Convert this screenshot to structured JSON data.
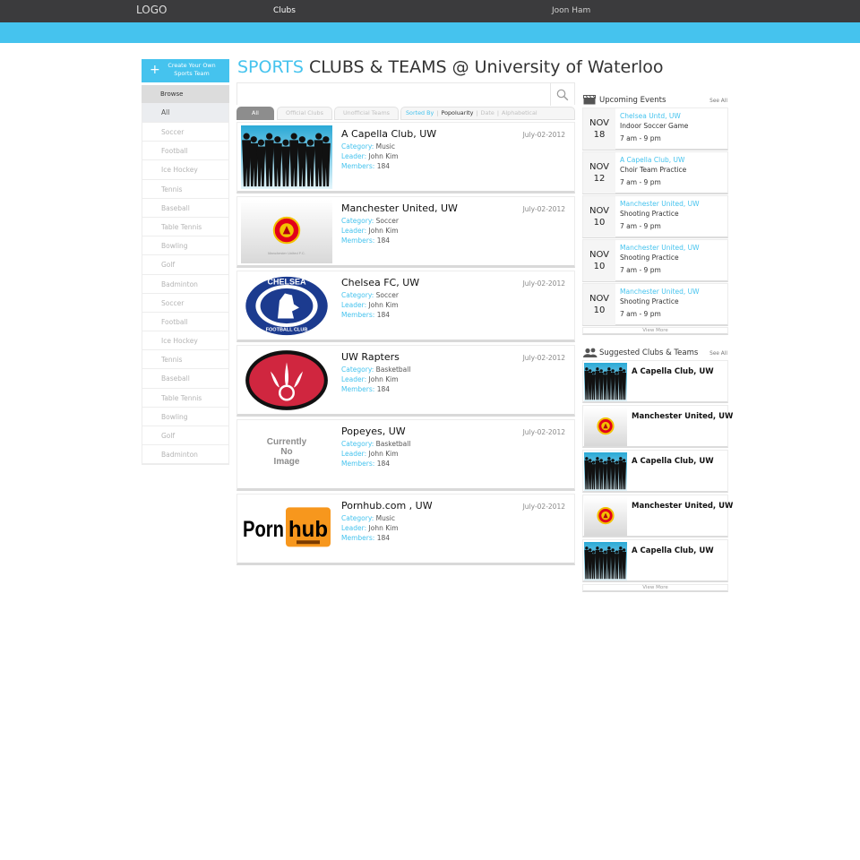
{
  "topbar": {
    "logo": "LOGO",
    "nav_clubs": "Clubs",
    "user": "Joon Ham"
  },
  "sidebar": {
    "create_label": "Create Your Own Sports Team",
    "browse_label": "Browse",
    "items": [
      "All",
      "Soccer",
      "Football",
      "Ice Hockey",
      "Tennis",
      "Baseball",
      "Table Tennis",
      "Bowling",
      "Golf",
      "Badminton",
      "Soccer",
      "Football",
      "Ice Hockey",
      "Tennis",
      "Baseball",
      "Table Tennis",
      "Bowling",
      "Golf",
      "Badminton"
    ]
  },
  "header": {
    "highlight": "SPORTS",
    "rest": " CLUBS & TEAMS @ University of Waterloo"
  },
  "filters": {
    "tabs": [
      "All",
      "Official Clubs",
      "Unofficial Teams"
    ],
    "sorted_by": "Sorted By",
    "sort_options": [
      "Popoluarity",
      "Date",
      "Alphabetical"
    ]
  },
  "club_labels": {
    "category": "Category:",
    "leader": "Leader:",
    "members": "Members:"
  },
  "clubs": [
    {
      "name": "A Capella Club, UW",
      "date": "July-02-2012",
      "category": "Music",
      "leader": "John Kim",
      "members": "184",
      "image": "silhouette-group"
    },
    {
      "name": "Manchester United, UW",
      "date": "July-02-2012",
      "category": "Soccer",
      "leader": "John Kim",
      "members": "184",
      "image": "manutd-crest",
      "image_caption": "Manchester United F.C."
    },
    {
      "name": "Chelsea FC, UW",
      "date": "July-02-2012",
      "category": "Soccer",
      "leader": "John Kim",
      "members": "184",
      "image": "chelsea-crest",
      "image_text_top": "CHELSEA",
      "image_text_bottom": "FOOTBALL CLUB"
    },
    {
      "name": "UW Rapters",
      "date": "July-02-2012",
      "category": "Basketball",
      "leader": "John Kim",
      "members": "184",
      "image": "raptors-logo"
    },
    {
      "name": "Popeyes, UW",
      "date": "July-02-2012",
      "category": "Basketball",
      "leader": "John Kim",
      "members": "184",
      "image": "no-image",
      "image_text": [
        "Currently",
        "No",
        "Image"
      ]
    },
    {
      "name": "Pornhub.com , UW",
      "date": "July-02-2012",
      "category": "Music",
      "leader": "John Kim",
      "members": "184",
      "image": "pornhub-logo",
      "image_text_a": "Porn",
      "image_text_b": "hub"
    }
  ],
  "events": {
    "title": "Upcoming Events",
    "see_all": "See All",
    "view_more": "View More",
    "items": [
      {
        "month": "NOV",
        "day": "18",
        "org": "Chelsea Untd, UW",
        "title": "Indoor Soccer Game",
        "time": "7 am - 9 pm"
      },
      {
        "month": "NOV",
        "day": "12",
        "org": "A Capella Club, UW",
        "title": "Choir Team Practice",
        "time": "7 am - 9 pm"
      },
      {
        "month": "NOV",
        "day": "10",
        "org": "Manchester United, UW",
        "title": "Shooting Practice",
        "time": "7 am - 9 pm"
      },
      {
        "month": "NOV",
        "day": "10",
        "org": "Manchester United, UW",
        "title": "Shooting Practice",
        "time": "7 am - 9 pm"
      },
      {
        "month": "NOV",
        "day": "10",
        "org": "Manchester United, UW",
        "title": "Shooting Practice",
        "time": "7 am - 9 pm"
      }
    ]
  },
  "suggested": {
    "title": "Suggested Clubs & Teams",
    "see_all": "See All",
    "view_more": "View More",
    "items": [
      {
        "name": "A Capella Club, UW",
        "image": "silhouette-group"
      },
      {
        "name": "Manchester United, UW",
        "image": "manutd-crest"
      },
      {
        "name": "A Capella Club, UW",
        "image": "silhouette-group"
      },
      {
        "name": "Manchester United, UW",
        "image": "manutd-crest"
      },
      {
        "name": "A Capella Club, UW",
        "image": "silhouette-group"
      }
    ]
  },
  "colors": {
    "accent": "#45c3ee",
    "topbar": "#3b3b3d",
    "raptors_red": "#d0263f",
    "pornhub_orange": "#f7971d"
  }
}
